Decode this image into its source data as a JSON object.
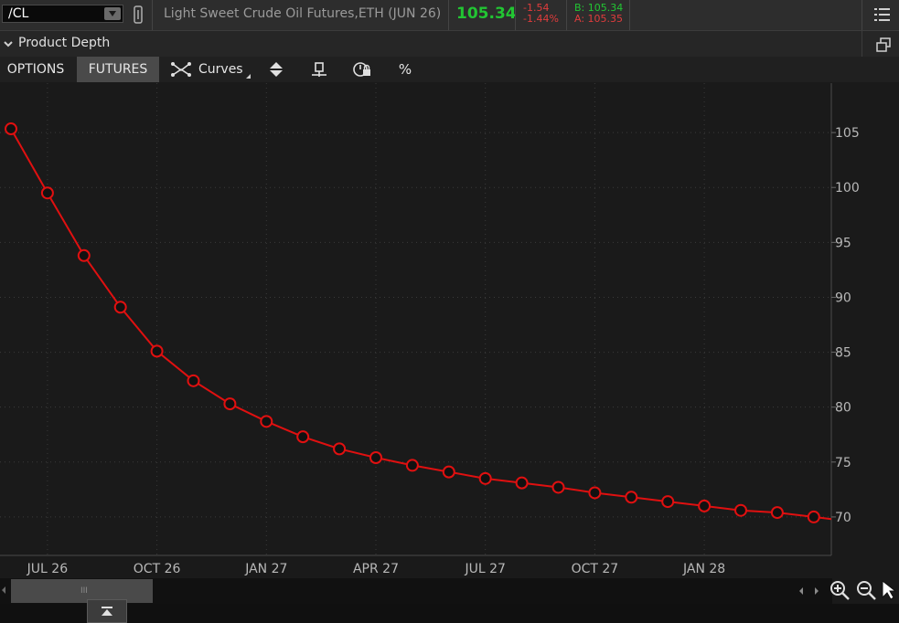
{
  "topbar": {
    "symbol": "/CL",
    "instrument_name": "Light Sweet Crude Oil Futures,ETH (JUN 26)",
    "last_price": "105.34",
    "net_change": "-1.54",
    "net_change_pct": "-1.44%",
    "bid": "B: 105.34",
    "ask": "A: 105.35",
    "icons": [
      "chevron-down-icon",
      "link-icon",
      "menu-icon"
    ]
  },
  "section": {
    "title": "Product Depth",
    "icons": [
      "collapse-chevron-icon",
      "popout-icon"
    ]
  },
  "toolbar": {
    "tabs": [
      {
        "label": "OPTIONS",
        "active": false
      },
      {
        "label": "FUTURES",
        "active": true
      }
    ],
    "curves_label": "Curves",
    "percent_label": "%",
    "icons": [
      "curves-icon",
      "sort-icon",
      "range-icon",
      "lock-icon"
    ]
  },
  "colors": {
    "line": "#e01010",
    "price_up": "#22c533",
    "price_down": "#e03c3c",
    "background": "#1a1a1a",
    "grid": "#3a3a3a"
  },
  "chart_data": {
    "type": "line",
    "series": [
      {
        "x": [
          "2026-06",
          "2026-07",
          "2026-08",
          "2026-09",
          "2026-10",
          "2026-11",
          "2026-12",
          "2027-01",
          "2027-02",
          "2027-03",
          "2027-04",
          "2027-05",
          "2027-06",
          "2027-07",
          "2027-08",
          "2027-09",
          "2027-10",
          "2027-11",
          "2027-12",
          "2028-01",
          "2028-02",
          "2028-03",
          "2028-04"
        ],
        "values": [
          105.34,
          99.5,
          93.8,
          89.1,
          85.1,
          82.4,
          80.3,
          78.7,
          77.3,
          76.2,
          75.4,
          74.7,
          74.1,
          73.5,
          73.1,
          72.7,
          72.2,
          71.8,
          71.4,
          71.0,
          70.6,
          70.4,
          70.0
        ]
      }
    ],
    "x_ticks": [
      "JUL 26",
      "OCT 26",
      "JAN 27",
      "APR 27",
      "JUL 27",
      "OCT 27",
      "JAN 28"
    ],
    "y_ticks": [
      105,
      100,
      95,
      90,
      85,
      80,
      75,
      70
    ],
    "ylim": [
      66.5,
      109.5
    ],
    "grid": true,
    "y_axis_side": "right"
  },
  "bottom": {
    "scroll_grip": "III",
    "icons": [
      "zoom-in-icon",
      "zoom-out-icon",
      "cursor-icon",
      "expand-up-icon"
    ]
  }
}
